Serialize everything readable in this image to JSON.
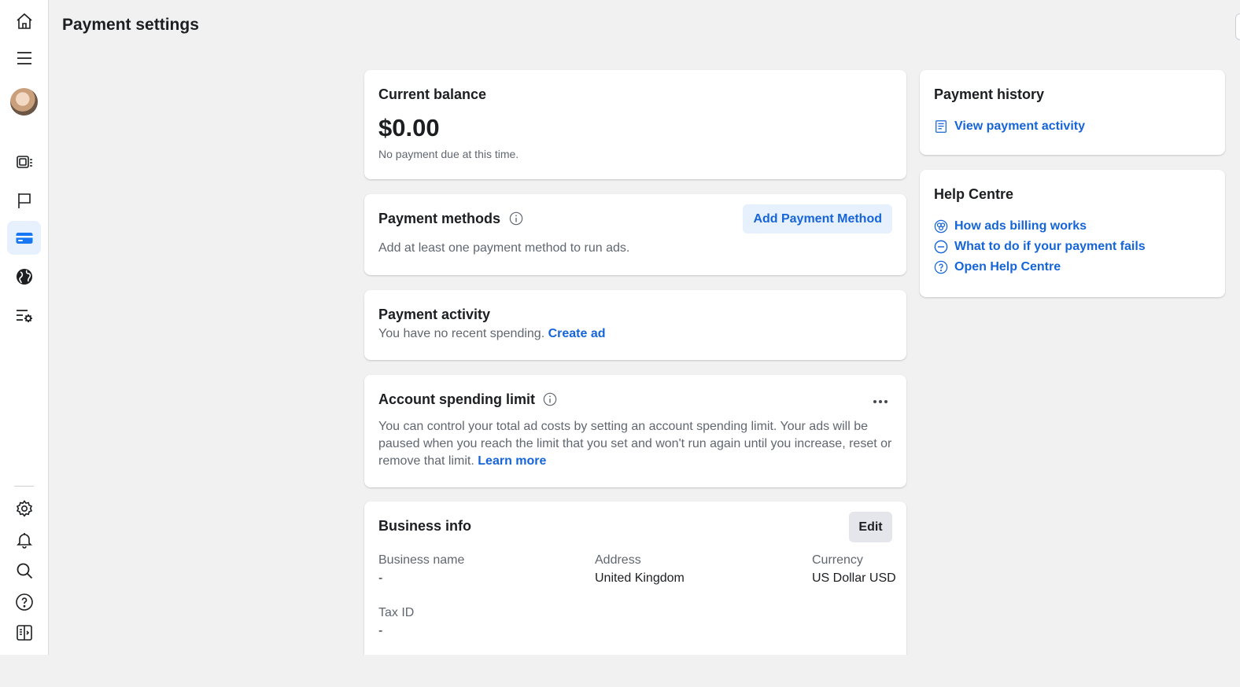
{
  "page": {
    "title": "Payment settings"
  },
  "sidebar": {
    "items": [
      {
        "name": "home",
        "icon": "home-icon"
      },
      {
        "name": "menu",
        "icon": "hamburger-menu-icon"
      },
      {
        "name": "ads-manager",
        "icon": "ads-manager-icon"
      },
      {
        "name": "pages",
        "icon": "flag-icon"
      },
      {
        "name": "billing",
        "icon": "credit-card-icon",
        "active": true
      },
      {
        "name": "audience",
        "icon": "globe-icon"
      },
      {
        "name": "settings-list",
        "icon": "list-settings-icon"
      },
      {
        "name": "settings",
        "icon": "gear-icon"
      },
      {
        "name": "notifications",
        "icon": "bell-icon"
      },
      {
        "name": "search",
        "icon": "search-icon"
      },
      {
        "name": "help",
        "icon": "help-icon"
      },
      {
        "name": "toggle-panel",
        "icon": "panel-toggle-icon"
      }
    ]
  },
  "current_balance": {
    "title": "Current balance",
    "amount": "$0.00",
    "note": "No payment due at this time."
  },
  "payment_methods": {
    "title": "Payment methods",
    "add_button": "Add Payment Method",
    "description": "Add at least one payment method to run ads."
  },
  "payment_activity": {
    "title": "Payment activity",
    "text": "You have no recent spending.",
    "link": "Create ad"
  },
  "spending_limit": {
    "title": "Account spending limit",
    "text": "You can control your total ad costs by setting an account spending limit. Your ads will be paused when you reach the limit that you set and won't run again until you increase, reset or remove that limit.",
    "link": "Learn more"
  },
  "business_info": {
    "title": "Business info",
    "edit_button": "Edit",
    "fields": {
      "business_name": {
        "label": "Business name",
        "value": "-"
      },
      "address": {
        "label": "Address",
        "value": "United Kingdom"
      },
      "currency": {
        "label": "Currency",
        "value": "US Dollar USD"
      },
      "tax_id": {
        "label": "Tax ID",
        "value": "-"
      }
    }
  },
  "payment_history": {
    "title": "Payment history",
    "link": "View payment activity"
  },
  "help_centre": {
    "title": "Help Centre",
    "links": [
      {
        "label": "How ads billing works",
        "icon": "billing-coins-icon"
      },
      {
        "label": "What to do if your payment fails",
        "icon": "minus-circle-icon"
      },
      {
        "label": "Open Help Centre",
        "icon": "question-circle-icon"
      }
    ]
  },
  "colors": {
    "link": "#1665d8",
    "button_blue_bg": "#e7f0fd",
    "page_bg": "#f1f1f1",
    "active_nav": "#1877f2"
  }
}
